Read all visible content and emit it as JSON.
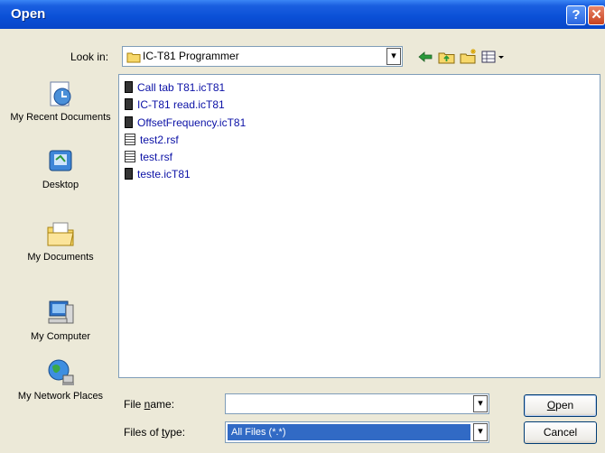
{
  "window": {
    "title": "Open",
    "help_label": "?",
    "close_label": "✕"
  },
  "toolbar": {
    "look_in_label": "Look in:",
    "look_in_value": "IC-T81 Programmer",
    "tools": [
      {
        "name": "back-icon",
        "glyph": "⇦"
      },
      {
        "name": "up-folder-icon",
        "glyph": "⬚"
      },
      {
        "name": "new-folder-icon",
        "glyph": "✱"
      },
      {
        "name": "views-menu-icon",
        "glyph": "▦▾"
      }
    ]
  },
  "places": [
    {
      "label": "My Recent Documents"
    },
    {
      "label": "Desktop"
    },
    {
      "label": "My Documents"
    },
    {
      "label": "My Computer"
    },
    {
      "label": "My Network Places"
    }
  ],
  "files": [
    {
      "name": "Call tab T81.icT81",
      "icon": "ict81-file-icon"
    },
    {
      "name": "IC-T81 read.icT81",
      "icon": "ict81-file-icon"
    },
    {
      "name": "OffsetFrequency.icT81",
      "icon": "ict81-file-icon"
    },
    {
      "name": "test2.rsf",
      "icon": "rsf-file-icon"
    },
    {
      "name": "test.rsf",
      "icon": "rsf-file-icon"
    },
    {
      "name": "teste.icT81",
      "icon": "ict81-file-icon"
    }
  ],
  "bottom": {
    "file_name_label": "File name:",
    "file_name_value": "",
    "file_type_label": "Files of type:",
    "file_type_value": "All Files (*.*)",
    "open_label": "Open",
    "cancel_label": "Cancel"
  },
  "colors": {
    "title_bar": "#0a4fd6",
    "file_text": "#0b11a6",
    "selection": "#316ac5"
  }
}
